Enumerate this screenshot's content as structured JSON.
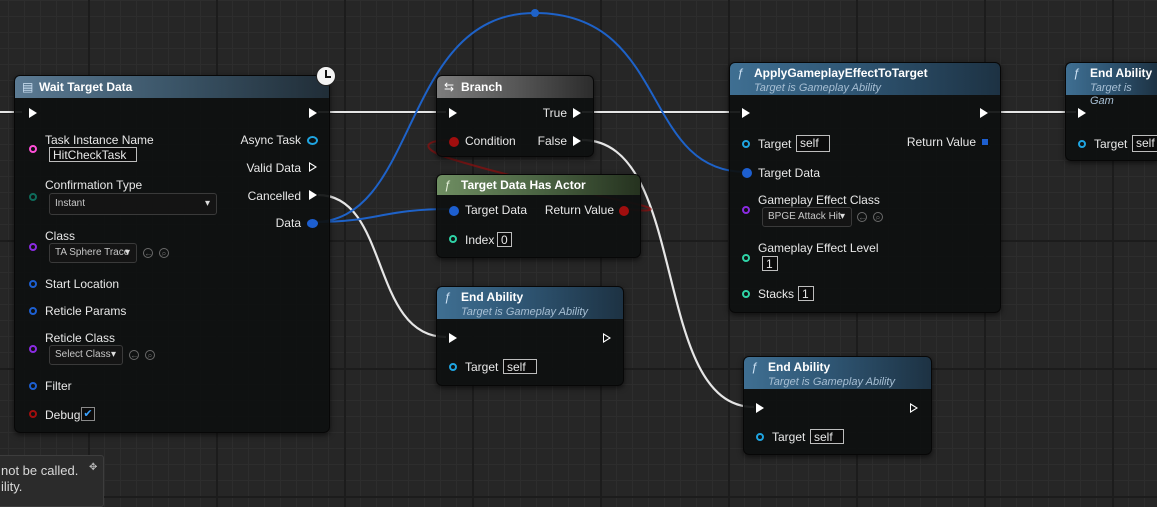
{
  "colors": {
    "exec": "#ffffff",
    "object_pin": "#1fa4e0",
    "struct_pin": "#1d5fd0",
    "class_pin": "#8a2be2",
    "bool_pin": "#a10e0e",
    "int_pin": "#2fd3a6",
    "enum_pin": "#0e6b5b",
    "string_pin": "#ff4fd8",
    "data_wire": "#1e62c8"
  },
  "wait_target_data": {
    "title": "Wait Target Data",
    "task_instance_name_label": "Task Instance Name",
    "task_instance_name_value": "HitCheckTask",
    "confirmation_type_label": "Confirmation Type",
    "confirmation_type_value": "Instant",
    "class_label": "Class",
    "class_value": "TA Sphere Trace",
    "start_location_label": "Start Location",
    "reticle_params_label": "Reticle Params",
    "reticle_class_label": "Reticle Class",
    "reticle_class_value": "Select Class",
    "filter_label": "Filter",
    "debug_label": "Debug",
    "debug_checked": true,
    "async_task_label": "Async Task",
    "valid_data_label": "Valid Data",
    "cancelled_label": "Cancelled",
    "data_label": "Data",
    "icon": "clock-icon"
  },
  "branch": {
    "title": "Branch",
    "condition_label": "Condition",
    "true_label": "True",
    "false_label": "False",
    "icon": "branch-icon"
  },
  "target_data_has_actor": {
    "title": "Target Data Has Actor",
    "target_data_label": "Target Data",
    "return_value_label": "Return Value",
    "index_label": "Index",
    "index_value": "0"
  },
  "end_ability_1": {
    "title": "End Ability",
    "subtitle": "Target is Gameplay Ability",
    "target_label": "Target",
    "target_value": "self"
  },
  "end_ability_2": {
    "title": "End Ability",
    "subtitle": "Target is Gameplay Ability",
    "target_label": "Target",
    "target_value": "self"
  },
  "end_ability_3": {
    "title": "End Ability",
    "subtitle": "Target is Gam",
    "target_label": "Target",
    "target_value": "self"
  },
  "apply_ge": {
    "title": "ApplyGameplayEffectToTarget",
    "subtitle": "Target is Gameplay Ability",
    "target_label": "Target",
    "target_value": "self",
    "target_data_label": "Target Data",
    "return_value_label": "Return Value",
    "ge_class_label": "Gameplay Effect Class",
    "ge_class_value": "BPGE Attack Hit",
    "ge_level_label": "Gameplay Effect Level",
    "ge_level_value": "1",
    "stacks_label": "Stacks",
    "stacks_value": "1"
  },
  "toast": {
    "line1": "not be called.",
    "line2": "ility."
  }
}
